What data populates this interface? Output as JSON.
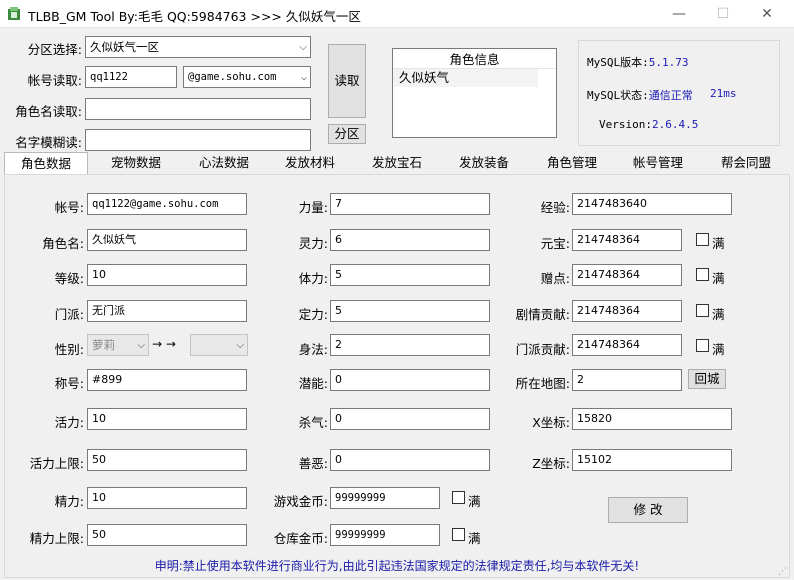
{
  "window": {
    "title": "TLBB_GM Tool By:毛毛 QQ:5984763 >>> 久似妖气一区",
    "minimize_glyph": "—",
    "maximize_glyph": "☐",
    "close_glyph": "✕"
  },
  "top": {
    "partition_label": "分区选择:",
    "partition_value": "久似妖气一区",
    "account_read_label": "帐号读取:",
    "account_read_value": "qq1122",
    "domain_value": "@game.sohu.com",
    "charname_read_label": "角色名读取:",
    "charname_read_value": "",
    "fuzzy_read_label": "名字模糊读:",
    "fuzzy_read_value": "",
    "read_button": "读取",
    "partition_button": "分区",
    "char_info_header": "角色信息",
    "char_info_items": [
      "久似妖气"
    ]
  },
  "mysql": {
    "version_label": "MySQL版本:",
    "version_value": "5.1.73",
    "status_label": "MySQL状态:",
    "status_value": "通信正常",
    "latency": "21ms",
    "version2_label": "Version:",
    "version2_value": "2.6.4.5"
  },
  "tabs": [
    "角色数据",
    "宠物数据",
    "心法数据",
    "发放材料",
    "发放宝石",
    "发放装备",
    "角色管理",
    "帐号管理",
    "帮会同盟"
  ],
  "fields": {
    "account_label": "帐号:",
    "account_value": "qq1122@game.sohu.com",
    "charname_label": "角色名:",
    "charname_value": "久似妖气",
    "level_label": "等级:",
    "level_value": "10",
    "sect_label": "门派:",
    "sect_value": "无门派",
    "gender_label": "性别:",
    "gender_value": "萝莉",
    "gender_arrow": "→ →",
    "gender_target": "",
    "title_label": "称号:",
    "title_value": "#899",
    "vitality_label": "活力:",
    "vitality_value": "10",
    "vitality_max_label": "活力上限:",
    "vitality_max_value": "50",
    "energy_label": "精力:",
    "energy_value": "10",
    "energy_max_label": "精力上限:",
    "energy_max_value": "50",
    "str_label": "力量:",
    "str_value": "7",
    "spi_label": "灵力:",
    "spi_value": "6",
    "con_label": "体力:",
    "con_value": "5",
    "int_label": "定力:",
    "int_value": "5",
    "dex_label": "身法:",
    "dex_value": "2",
    "potential_label": "潜能:",
    "potential_value": "0",
    "pk_label": "杀气:",
    "pk_value": "0",
    "karma_label": "善恶:",
    "karma_value": "0",
    "gold_label": "游戏金币:",
    "gold_value": "99999999",
    "bank_label": "仓库金币:",
    "bank_value": "99999999",
    "exp_label": "经验:",
    "exp_value": "2147483640",
    "yuanbao_label": "元宝:",
    "yuanbao_value": "214748364",
    "gift_label": "赠点:",
    "gift_value": "214748364",
    "story_label": "剧情贡献:",
    "story_value": "214748364",
    "sectcontrib_label": "门派贡献:",
    "sectcontrib_value": "214748364",
    "map_label": "所在地图:",
    "map_value": "2",
    "return_city_button": "回城",
    "x_label": "X坐标:",
    "x_value": "15820",
    "z_label": "Z坐标:",
    "z_value": "15102",
    "full_label": "满",
    "modify_button": "修 改"
  },
  "footer": "申明:禁止使用本软件进行商业行为,由此引起违法国家规定的法律规定责任,均与本软件无关!",
  "colors": {
    "footer_text": "#1a1aa8",
    "link_blue": "#1a1ab8"
  }
}
